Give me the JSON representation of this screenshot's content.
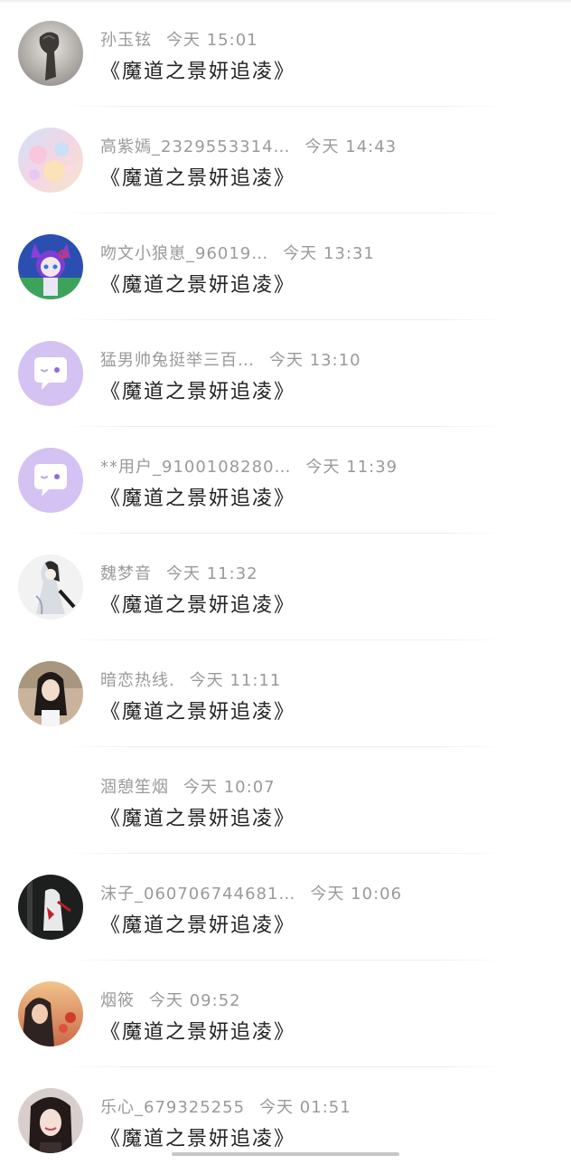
{
  "messages": [
    {
      "sender": "孙玉铉",
      "time": "今天 15:01",
      "text": "《魔道之景妍追凌》",
      "avatar": "statue-photo"
    },
    {
      "sender": "高紫嫣_2329553314…",
      "time": "今天 14:43",
      "text": "《魔道之景妍追凌》",
      "avatar": "pastel-illustration"
    },
    {
      "sender": "吻文小狼崽_96019…",
      "time": "今天 13:31",
      "text": "《魔道之景妍追凌》",
      "avatar": "anime-catgirl"
    },
    {
      "sender": "猛男帅兔挺举三百…",
      "time": "今天 13:10",
      "text": "《魔道之景妍追凌》",
      "avatar": "default-chat-bubble"
    },
    {
      "sender": "**用户_9100108280…",
      "time": "今天 11:39",
      "text": "《魔道之景妍追凌》",
      "avatar": "default-chat-bubble"
    },
    {
      "sender": "魏梦音",
      "time": "今天 11:32",
      "text": "《魔道之景妍追凌》",
      "avatar": "ink-drawing"
    },
    {
      "sender": "暗恋热线.",
      "time": "今天 11:11",
      "text": "《魔道之景妍追凌》",
      "avatar": "girl-portrait"
    },
    {
      "sender": "涸憩笙烟",
      "time": "今天 10:07",
      "text": "《魔道之景妍追凌》",
      "avatar": "none"
    },
    {
      "sender": "沫子_060706744681…",
      "time": "今天 10:06",
      "text": "《魔道之景妍追凌》",
      "avatar": "dark-illustration"
    },
    {
      "sender": "烟筱",
      "time": "今天 09:52",
      "text": "《魔道之景妍追凌》",
      "avatar": "sunset-portrait"
    },
    {
      "sender": "乐心_679325255",
      "time": "今天 01:51",
      "text": "《魔道之景妍追凌》",
      "avatar": "girl-selfie"
    }
  ],
  "colors": {
    "default_avatar_bg": "#d4c2f2",
    "meta_text": "#9a9a9a",
    "message_text": "#222222"
  }
}
